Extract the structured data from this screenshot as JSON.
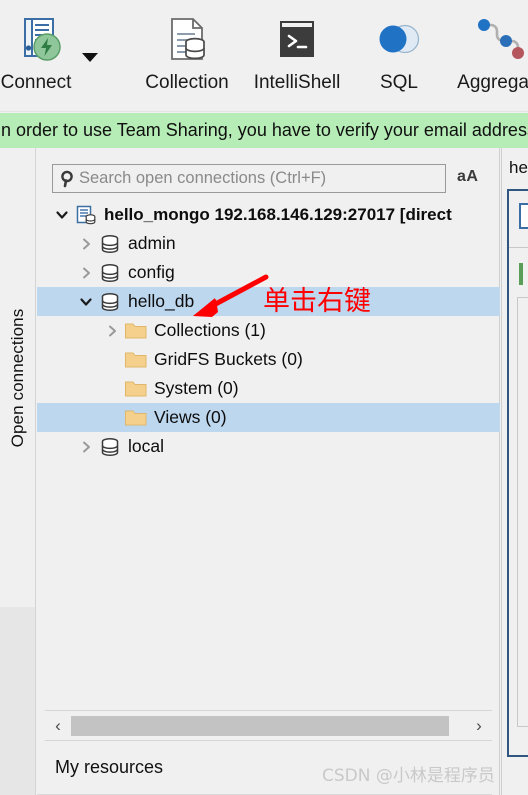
{
  "app": {
    "accent_blue": "#1f72c4",
    "selection_blue": "#bdd7ee",
    "banner_green": "#b6ecb6",
    "annotation_red": "#ff0000",
    "folder_yellow": "#f5d08c"
  },
  "ribbon": {
    "items": [
      {
        "label": "Connect",
        "icon": "connect-icon",
        "has_dropdown": true
      },
      {
        "label": "Collection",
        "icon": "collection-icon",
        "has_dropdown": false
      },
      {
        "label": "IntelliShell",
        "icon": "intellishell-icon",
        "has_dropdown": false
      },
      {
        "label": "SQL",
        "icon": "sql-icon",
        "has_dropdown": false
      },
      {
        "label": "Aggregate",
        "icon": "aggregate-icon",
        "has_dropdown": false
      }
    ]
  },
  "banner": {
    "text": "In order to use Team Sharing, you have to verify your email address"
  },
  "sidebar": {
    "vertical_label": "Open connections"
  },
  "search": {
    "placeholder": "Search open connections (Ctrl+F)",
    "value": "",
    "match_case_label": "aA"
  },
  "tree": {
    "rows": [
      {
        "label": "hello_mongo 192.168.146.129:27017 [direct",
        "indent": 0,
        "twisty": "expanded",
        "icon": "server-icon",
        "bold": true,
        "selected": false
      },
      {
        "label": "admin",
        "indent": 1,
        "twisty": "collapsed",
        "icon": "database-icon",
        "bold": false,
        "selected": false
      },
      {
        "label": "config",
        "indent": 1,
        "twisty": "collapsed",
        "icon": "database-icon",
        "bold": false,
        "selected": false
      },
      {
        "label": "hello_db",
        "indent": 1,
        "twisty": "expanded",
        "icon": "database-icon",
        "bold": false,
        "selected": true
      },
      {
        "label": "Collections (1)",
        "indent": 2,
        "twisty": "collapsed",
        "icon": "folder-icon",
        "bold": false,
        "selected": false
      },
      {
        "label": "GridFS Buckets (0)",
        "indent": 2,
        "twisty": "none",
        "icon": "folder-icon",
        "bold": false,
        "selected": false
      },
      {
        "label": "System (0)",
        "indent": 2,
        "twisty": "none",
        "icon": "folder-icon",
        "bold": false,
        "selected": false
      },
      {
        "label": "Views (0)",
        "indent": 2,
        "twisty": "none",
        "icon": "folder-icon",
        "bold": false,
        "selected": true
      },
      {
        "label": "local",
        "indent": 1,
        "twisty": "collapsed",
        "icon": "database-icon",
        "bold": false,
        "selected": false
      }
    ]
  },
  "scrollbar": {
    "left_arrow": "‹",
    "right_arrow": "›"
  },
  "footer": {
    "my_resources_label": "My resources"
  },
  "right_panel": {
    "tab_label": "he"
  },
  "annotation": {
    "text": "单击右键"
  },
  "watermark": {
    "text": "CSDN @小林是程序员"
  }
}
